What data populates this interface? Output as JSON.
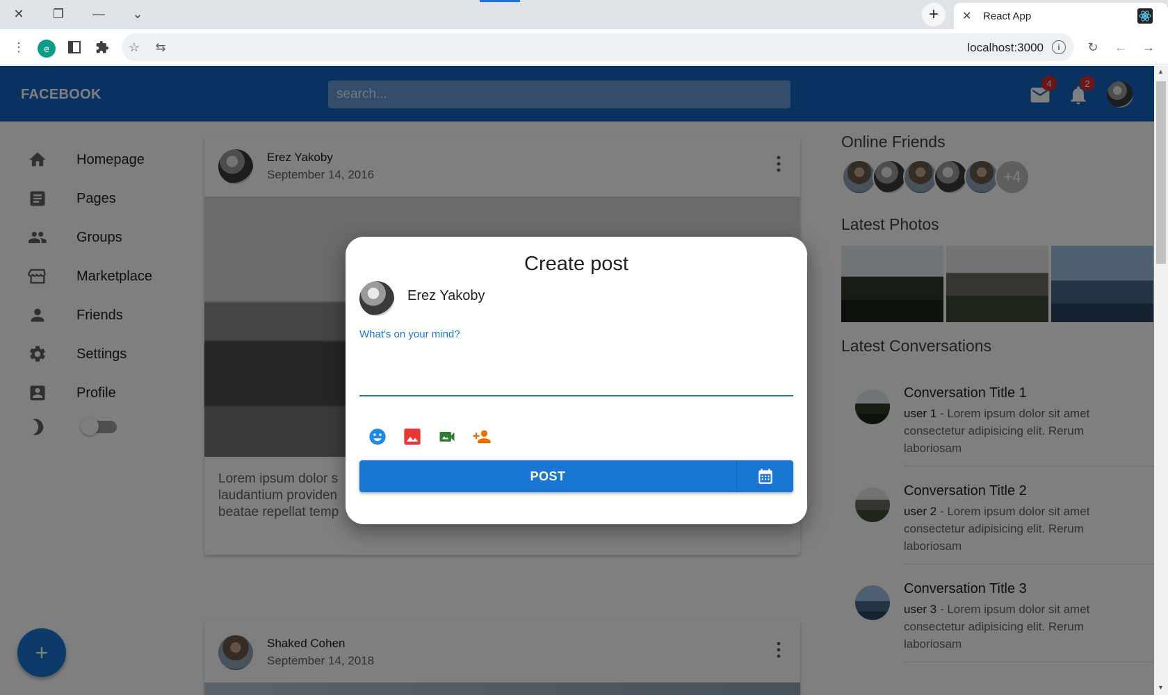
{
  "browser": {
    "tab_title": "React App",
    "url": "localhost:3000",
    "extension_initial": "e"
  },
  "app": {
    "brand": "FACEBOOK",
    "search_placeholder": "search...",
    "mail_count": "4",
    "notification_count": "2"
  },
  "sidebar": {
    "items": [
      {
        "label": "Homepage",
        "icon": "home-icon"
      },
      {
        "label": "Pages",
        "icon": "article-icon"
      },
      {
        "label": "Groups",
        "icon": "groups-icon"
      },
      {
        "label": "Marketplace",
        "icon": "storefront-icon"
      },
      {
        "label": "Friends",
        "icon": "person-icon"
      },
      {
        "label": "Settings",
        "icon": "settings-gear-icon"
      },
      {
        "label": "Profile",
        "icon": "account-box-icon"
      }
    ],
    "dark_mode_icon": "dark-mode-moon-icon",
    "dark_mode_on": false
  },
  "feed": {
    "posts": [
      {
        "author": "Erez Yakoby",
        "date": "September 14, 2016",
        "text": "Lorem ipsum dolor s\nlaudantium providen\nbeatae repellat temp"
      },
      {
        "author": "Shaked Cohen",
        "date": "September 14, 2018"
      }
    ]
  },
  "right": {
    "online_friends_title": "Online Friends",
    "online_more": "+4",
    "latest_photos_title": "Latest Photos",
    "latest_conversations_title": "Latest Conversations",
    "conversations": [
      {
        "title": "Conversation Title 1",
        "user": "user 1",
        "text": " - Lorem ipsum dolor sit amet consectetur adipisicing elit. Rerum laboriosam"
      },
      {
        "title": "Conversation Title 2",
        "user": "user 2",
        "text": " - Lorem ipsum dolor sit amet consectetur adipisicing elit. Rerum laboriosam"
      },
      {
        "title": "Conversation Title 3",
        "user": "user 3",
        "text": " - Lorem ipsum dolor sit amet consectetur adipisicing elit. Rerum laboriosam"
      }
    ]
  },
  "dialog": {
    "title": "Create post",
    "author": "Erez Yakoby",
    "field_label": "What's on your mind?",
    "post_label": "POST",
    "tools": [
      "emoji-icon",
      "image-icon",
      "video-icon",
      "tag-person-icon"
    ],
    "colors": {
      "emoji": "#1e88e5",
      "image": "#e53935",
      "video": "#2e7d32",
      "tag": "#ef6c00",
      "primary": "#1976d2"
    }
  }
}
